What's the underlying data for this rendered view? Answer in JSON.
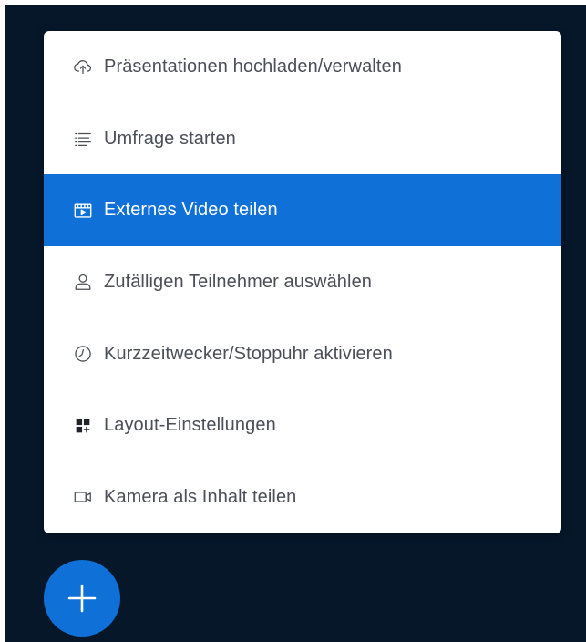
{
  "colors": {
    "background": "#06172a",
    "menu_background": "#ffffff",
    "accent": "#0f70d7",
    "text": "#4b4f57",
    "active_text": "#ffffff"
  },
  "menu": {
    "items": [
      {
        "label": "Präsentationen hochladen/verwalten",
        "icon": "cloud-upload-icon",
        "active": false
      },
      {
        "label": "Umfrage starten",
        "icon": "list-icon",
        "active": false
      },
      {
        "label": "Externes Video teilen",
        "icon": "video-player-icon",
        "active": true
      },
      {
        "label": "Zufälligen Teilnehmer auswählen",
        "icon": "user-icon",
        "active": false
      },
      {
        "label": "Kurzzeitwecker/Stoppuhr aktivieren",
        "icon": "clock-icon",
        "active": false
      },
      {
        "label": "Layout-Einstellungen",
        "icon": "layout-grid-icon",
        "active": false
      },
      {
        "label": "Kamera als Inhalt teilen",
        "icon": "camera-icon",
        "active": false
      }
    ]
  },
  "fab": {
    "icon": "plus-icon"
  }
}
